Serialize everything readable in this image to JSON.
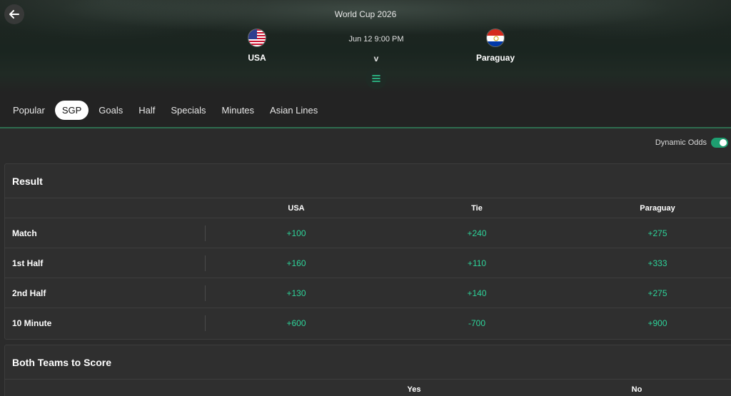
{
  "header": {
    "event": "World Cup 2026",
    "match_time": "Jun 12 9:00 PM",
    "vs": "v",
    "home_team": "USA",
    "away_team": "Paraguay"
  },
  "tabs": [
    {
      "label": "Popular",
      "active": false
    },
    {
      "label": "SGP",
      "active": true
    },
    {
      "label": "Goals",
      "active": false
    },
    {
      "label": "Half",
      "active": false
    },
    {
      "label": "Specials",
      "active": false
    },
    {
      "label": "Minutes",
      "active": false
    },
    {
      "label": "Asian Lines",
      "active": false
    }
  ],
  "dynamic_odds": {
    "label": "Dynamic Odds",
    "enabled": true
  },
  "result_market": {
    "title": "Result",
    "columns": [
      "USA",
      "Tie",
      "Paraguay"
    ],
    "rows": [
      {
        "label": "Match",
        "odds": [
          "+100",
          "+240",
          "+275"
        ]
      },
      {
        "label": "1st Half",
        "odds": [
          "+160",
          "+110",
          "+333"
        ]
      },
      {
        "label": "2nd Half",
        "odds": [
          "+130",
          "+140",
          "+275"
        ]
      },
      {
        "label": "10 Minute",
        "odds": [
          "+600",
          "-700",
          "+900"
        ]
      }
    ]
  },
  "btts_market": {
    "title": "Both Teams to Score",
    "columns": [
      "Yes",
      "No"
    ]
  },
  "colors": {
    "accent": "#2ed49a",
    "background": "#2b2b2b",
    "card": "#2f2f2f",
    "toggle_on": "#1e9e70"
  }
}
